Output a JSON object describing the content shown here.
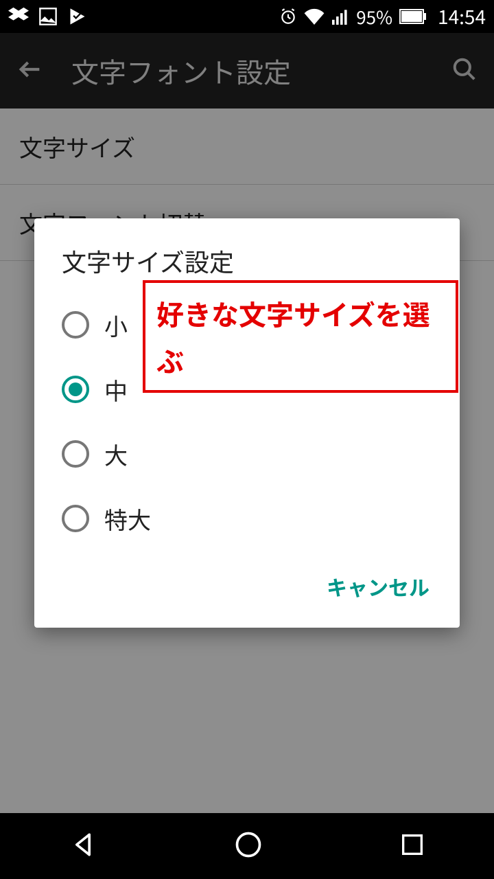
{
  "status": {
    "battery_pct": "95%",
    "time": "14:54"
  },
  "appbar": {
    "title": "文字フォント設定"
  },
  "page": {
    "row1": "文字サイズ",
    "row2": "文字フォント切替"
  },
  "dialog": {
    "title": "文字サイズ設定",
    "options": {
      "small": "小",
      "medium": "中",
      "large": "大",
      "xlarge": "特大"
    },
    "selected": "medium",
    "cancel": "キャンセル"
  },
  "annotation": {
    "text": "好きな文字サイズを選ぶ"
  },
  "colors": {
    "accent": "#009688",
    "anno": "#e40000"
  }
}
